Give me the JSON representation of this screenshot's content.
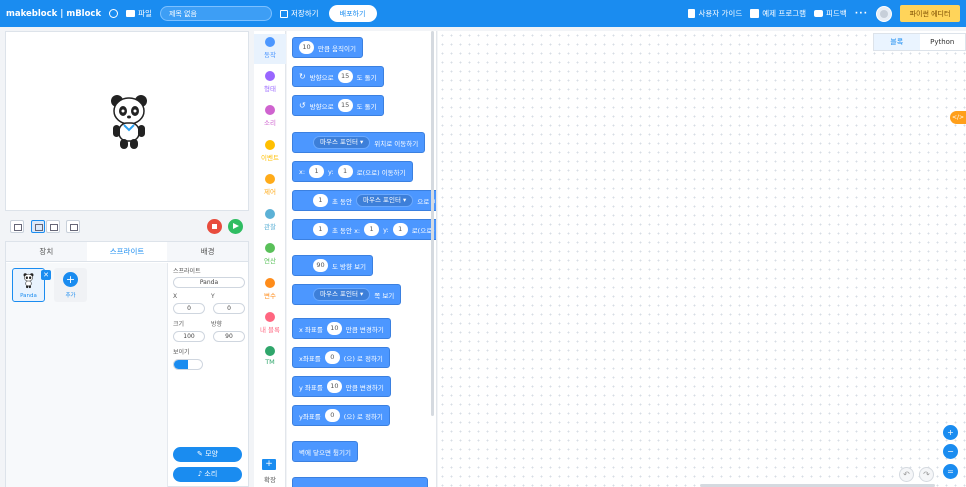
{
  "header": {
    "logo": "makeblock | mBlock",
    "file_label": "파일",
    "project_title": "제목 없음",
    "save_label": "저장하기",
    "publish_label": "배포하기",
    "guide_label": "사용자 가이드",
    "examples_label": "예제 프로그램",
    "feedback_label": "피드백",
    "more_label": "···",
    "python_label": "파이썬 에디터"
  },
  "stage": {
    "sprite_icon": "panda-sprite"
  },
  "sprite_panel": {
    "tabs": [
      "장치",
      "스프라이트",
      "배경"
    ],
    "active_tab": 1,
    "sprites": [
      {
        "name": "Panda"
      }
    ],
    "add_label": "추가",
    "props": {
      "sprite_label": "스프라이트",
      "sprite_name": "Panda",
      "x_label": "X",
      "y_label": "Y",
      "x_value": "0",
      "y_value": "0",
      "size_label": "크기",
      "direction_label": "방향",
      "size_value": "100",
      "direction_value": "90",
      "show_label": "보이기"
    },
    "costume_label": "모양",
    "sound_label": "소리"
  },
  "categories": [
    {
      "label": "동작",
      "color": "#4c97ff"
    },
    {
      "label": "형태",
      "color": "#9966ff"
    },
    {
      "label": "소리",
      "color": "#cf63cf"
    },
    {
      "label": "이벤트",
      "color": "#ffbf00"
    },
    {
      "label": "제어",
      "color": "#ffab19"
    },
    {
      "label": "관찰",
      "color": "#5cb1d6"
    },
    {
      "label": "연산",
      "color": "#59c059"
    },
    {
      "label": "변수",
      "color": "#ff8c1a"
    },
    {
      "label": "내 블록",
      "color": "#ff6680"
    },
    {
      "label": "TM",
      "color": "#2fa66b"
    }
  ],
  "extension_label": "확장",
  "blocks": {
    "move": {
      "num": "10",
      "text": "만큼 움직이기"
    },
    "turn_right": {
      "pre": "방향으로",
      "num": "15",
      "text": "도 돌기"
    },
    "turn_left": {
      "pre": "방향으로",
      "num": "15",
      "text": "도 돌기"
    },
    "goto": {
      "drop": "마우스 포인터 ▾",
      "text": "위치로 이동하기"
    },
    "goto_xy": {
      "x": "x:",
      "xv": "1",
      "y": "y:",
      "yv": "1",
      "text": "로(으로) 이동하기"
    },
    "glide_to": {
      "num": "1",
      "mid": "초 동안",
      "drop": "마우스 포인터 ▾",
      "text": "으로 이동하기"
    },
    "glide_xy": {
      "num": "1",
      "mid": "초 동안 x:",
      "xv": "1",
      "y": "y:",
      "yv": "1",
      "text": "로(으로) 이동하기"
    },
    "point_dir": {
      "num": "90",
      "text": "도 방향 보기"
    },
    "point_towards": {
      "drop": "마우스 포인터 ▾",
      "text": "쪽 보기"
    },
    "change_x": {
      "pre": "x 좌표를",
      "num": "10",
      "text": "만큼 변경하기"
    },
    "set_x": {
      "pre": "x좌표를",
      "num": "0",
      "text": "(으) 로 정하기"
    },
    "change_y": {
      "pre": "y 좌표를",
      "num": "10",
      "text": "만큼 변경하기"
    },
    "set_y": {
      "pre": "y좌표를",
      "num": "0",
      "text": "(으) 로 정하기"
    },
    "bounce": {
      "text": "벽에 닿으면 튕기기"
    }
  },
  "workspace": {
    "mode_blocks": "블록",
    "mode_python": "Python",
    "code_tab": "</>"
  }
}
